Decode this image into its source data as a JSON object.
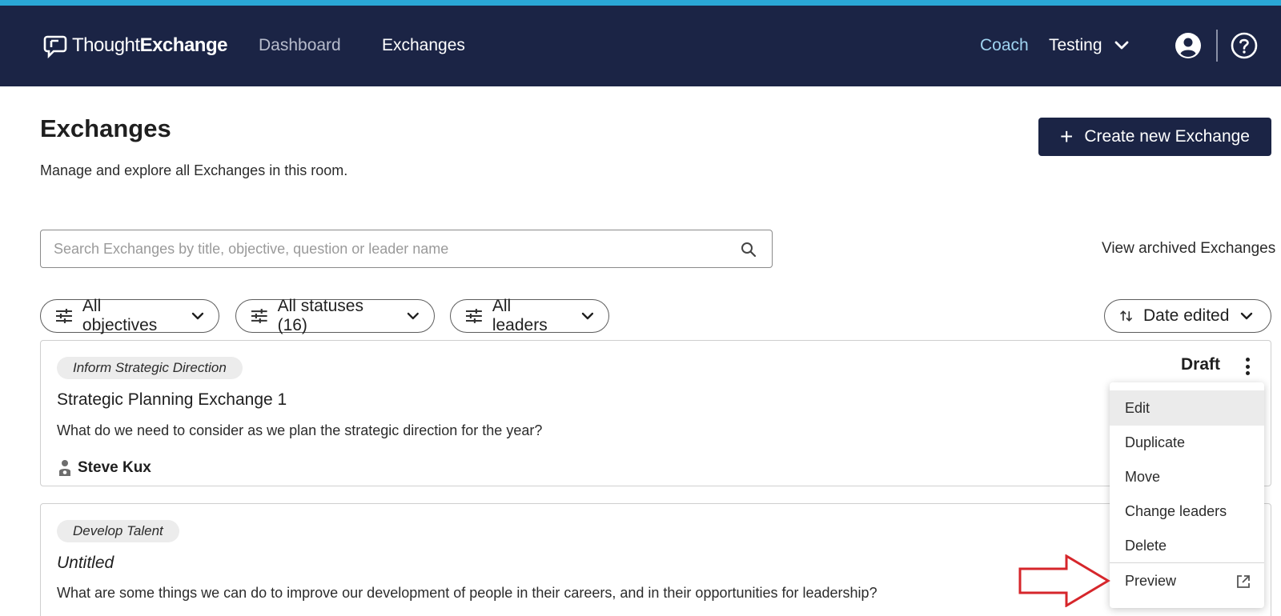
{
  "header": {
    "logo_text_light": "Thought",
    "logo_text_bold": "Exchange",
    "nav": [
      {
        "label": "Dashboard"
      },
      {
        "label": "Exchanges"
      }
    ],
    "coach_label": "Coach",
    "room_label": "Testing",
    "icons": [
      "logo-icon",
      "chevron-down-icon",
      "account-circle-icon",
      "help-circle-icon"
    ]
  },
  "page": {
    "title": "Exchanges",
    "subtitle": "Manage and explore all Exchanges in this room.",
    "create_button": "Create new Exchange",
    "search_placeholder": "Search Exchanges by title, objective, question or leader name",
    "view_archived": "View archived Exchanges"
  },
  "filters": [
    {
      "label": "All objectives"
    },
    {
      "label": "All statuses (16)"
    },
    {
      "label": "All leaders"
    }
  ],
  "sort": {
    "label": "Date edited"
  },
  "exchanges": [
    {
      "objective": "Inform Strategic Direction",
      "title": "Strategic Planning Exchange 1",
      "question": "What do we need to consider as we plan the strategic direction for the year?",
      "leader": "Steve Kux",
      "status": "Draft"
    },
    {
      "objective": "Develop Talent",
      "title": "Untitled",
      "question": "What are some things we can do to improve our development of people in their careers, and in their opportunities for leadership?"
    }
  ],
  "context_menu": {
    "items": [
      {
        "label": "Edit"
      },
      {
        "label": "Duplicate"
      },
      {
        "label": "Move"
      },
      {
        "label": "Change leaders"
      },
      {
        "label": "Delete"
      },
      {
        "label": "Preview"
      }
    ]
  },
  "colors": {
    "navbar": "#1b2445",
    "top_stripe": "#2aa7d6",
    "coach_link": "#9fd3f0",
    "annotation_arrow": "#d6262b"
  }
}
